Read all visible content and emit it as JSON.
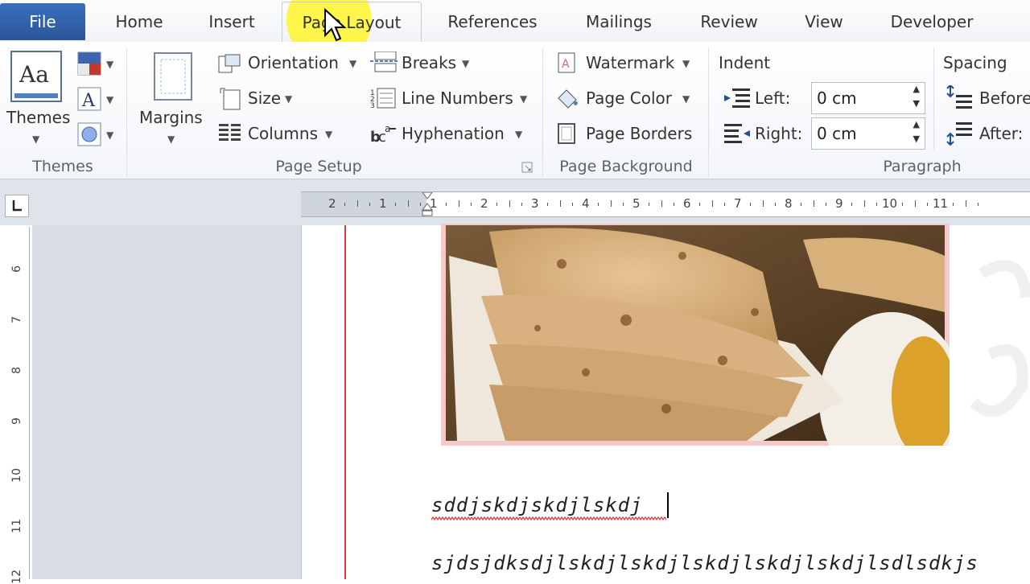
{
  "tabs": {
    "file": "File",
    "home": "Home",
    "insert": "Insert",
    "page_layout": "Page Layout",
    "references": "References",
    "mailings": "Mailings",
    "review": "Review",
    "view": "View",
    "developer": "Developer"
  },
  "ribbon": {
    "themes": {
      "button": "Themes",
      "group_label": "Themes"
    },
    "page_setup": {
      "margins": "Margins",
      "orientation": "Orientation",
      "size": "Size",
      "columns": "Columns",
      "breaks": "Breaks",
      "line_numbers": "Line Numbers",
      "hyphenation": "Hyphenation",
      "group_label": "Page Setup"
    },
    "page_background": {
      "watermark": "Watermark",
      "page_color": "Page Color",
      "page_borders": "Page Borders",
      "group_label": "Page Background"
    },
    "paragraph": {
      "indent_title": "Indent",
      "left_label": "Left:",
      "left_value": "0 cm",
      "right_label": "Right:",
      "right_value": "0 cm",
      "spacing_title": "Spacing",
      "before_label": "Before",
      "after_label": "After:",
      "group_label": "Paragraph"
    }
  },
  "ruler": {
    "ticks": [
      "2",
      "1",
      "1",
      "2",
      "3",
      "4",
      "5",
      "6",
      "7",
      "8",
      "9",
      "10",
      "11"
    ],
    "vertical_ticks": [
      "6",
      "7",
      "8",
      "9",
      "10",
      "11",
      "12"
    ]
  },
  "document": {
    "line1": "sddjskdjskdjlskdj",
    "line2": "sjdsjdksdjlskdjlskdjlskdjlskdjlskdjlsdlsdkjs"
  },
  "colors": {
    "file_tab": "#2a5699",
    "highlight": "#fff43c",
    "margin_line": "#e03b3b"
  }
}
